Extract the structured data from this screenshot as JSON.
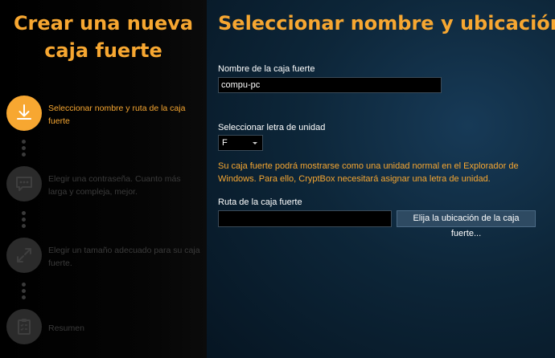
{
  "sidebar": {
    "title_line1": "Crear una nueva",
    "title_line2": "caja fuerte",
    "steps": [
      {
        "label": "Seleccionar nombre y ruta de la caja fuerte",
        "icon": "download-icon",
        "active": true
      },
      {
        "label": "Elegir una contraseña. Cuanto más larga y compleja, mejor.",
        "icon": "chat-bubble-icon",
        "active": false
      },
      {
        "label": "Elegir un tamaño adecuado para su caja fuerte.",
        "icon": "resize-arrows-icon",
        "active": false
      },
      {
        "label": "Resumen",
        "icon": "clipboard-checklist-icon",
        "active": false
      }
    ]
  },
  "main": {
    "title": "Seleccionar nombre y ubicación",
    "name_label": "Nombre de la caja fuerte",
    "name_value": "compu-pc",
    "drive_label": "Seleccionar letra de unidad",
    "drive_value": "F",
    "info_text": "Su caja fuerte podrá mostrarse como una unidad normal en el Explorador de Windows. Para ello, CryptBox necesitará asignar una letra de unidad.",
    "path_label": "Ruta de la caja fuerte",
    "path_value": "",
    "browse_button": "Elija la ubicación de la caja fuerte..."
  },
  "colors": {
    "accent": "#f7a731",
    "sidebar_bg": "#000000",
    "main_bg": "#0d2639",
    "inactive": "#2b2b2b"
  }
}
